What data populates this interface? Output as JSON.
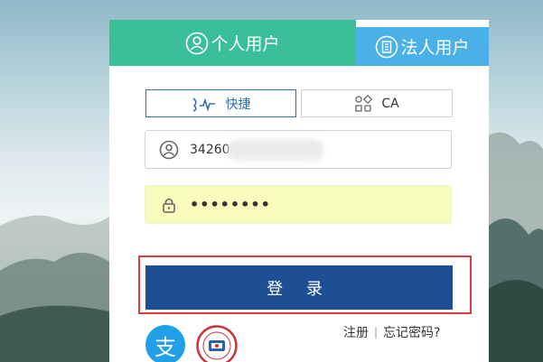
{
  "tabs": {
    "personal_label": "个人用户",
    "legal_label": "法人用户"
  },
  "login_modes": {
    "quick_label": "快捷",
    "ca_label": "CA"
  },
  "form": {
    "username_value": "34260",
    "password_value": "••••••••"
  },
  "login_button_label": "登 录",
  "links": {
    "register": "注册",
    "separator": "|",
    "forgot_password": "忘记密码?"
  },
  "third_party": {
    "alipay_glyph": "支",
    "ss_icon": "social-security-card-icon"
  },
  "colors": {
    "personal_tab": "#3bbf97",
    "legal_tab": "#4ab0e8",
    "login_button": "#1e4e93",
    "password_field": "#f7fbbc",
    "highlight": "#e23b3b"
  }
}
